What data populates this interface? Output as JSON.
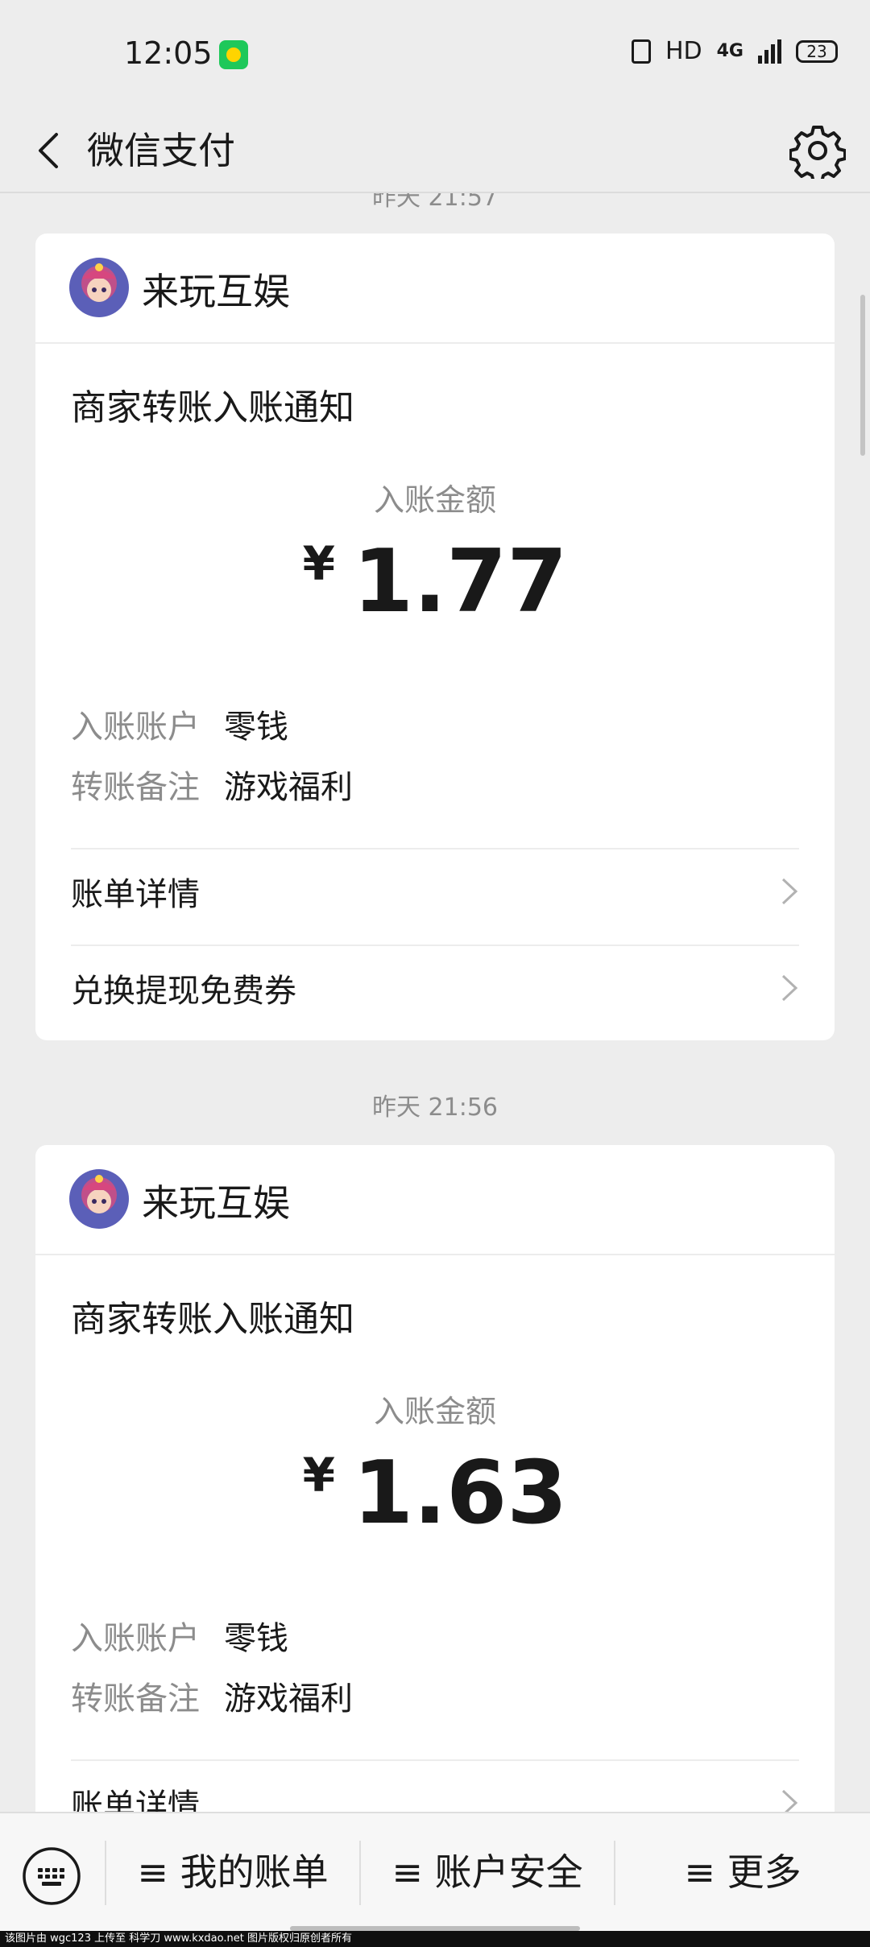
{
  "status_bar": {
    "time": "12:05",
    "hd": "HD",
    "network": "4G",
    "battery": "23"
  },
  "nav": {
    "title": "微信支付"
  },
  "messages": [
    {
      "timestamp": "昨天 21:57",
      "merchant": "来玩互娱",
      "notice_title": "商家转账入账通知",
      "amount_label": "入账金额",
      "currency": "¥",
      "amount": "1.77",
      "account_label": "入账账户",
      "account_value": "零钱",
      "remark_label": "转账备注",
      "remark_value": "游戏福利",
      "link_bill": "账单详情",
      "link_coupon": "兑换提现免费券"
    },
    {
      "timestamp": "昨天 21:56",
      "merchant": "来玩互娱",
      "notice_title": "商家转账入账通知",
      "amount_label": "入账金额",
      "currency": "¥",
      "amount": "1.63",
      "account_label": "入账账户",
      "account_value": "零钱",
      "remark_label": "转账备注",
      "remark_value": "游戏福利",
      "link_bill": "账单详情"
    }
  ],
  "bottom_menu": {
    "item1": "≡ 我的账单",
    "item2": "≡ 账户安全",
    "item3": "≡ 更多"
  },
  "footer_text": "该图片由 wgc123 上传至 科学刀 www.kxdao.net 图片版权归原创者所有"
}
